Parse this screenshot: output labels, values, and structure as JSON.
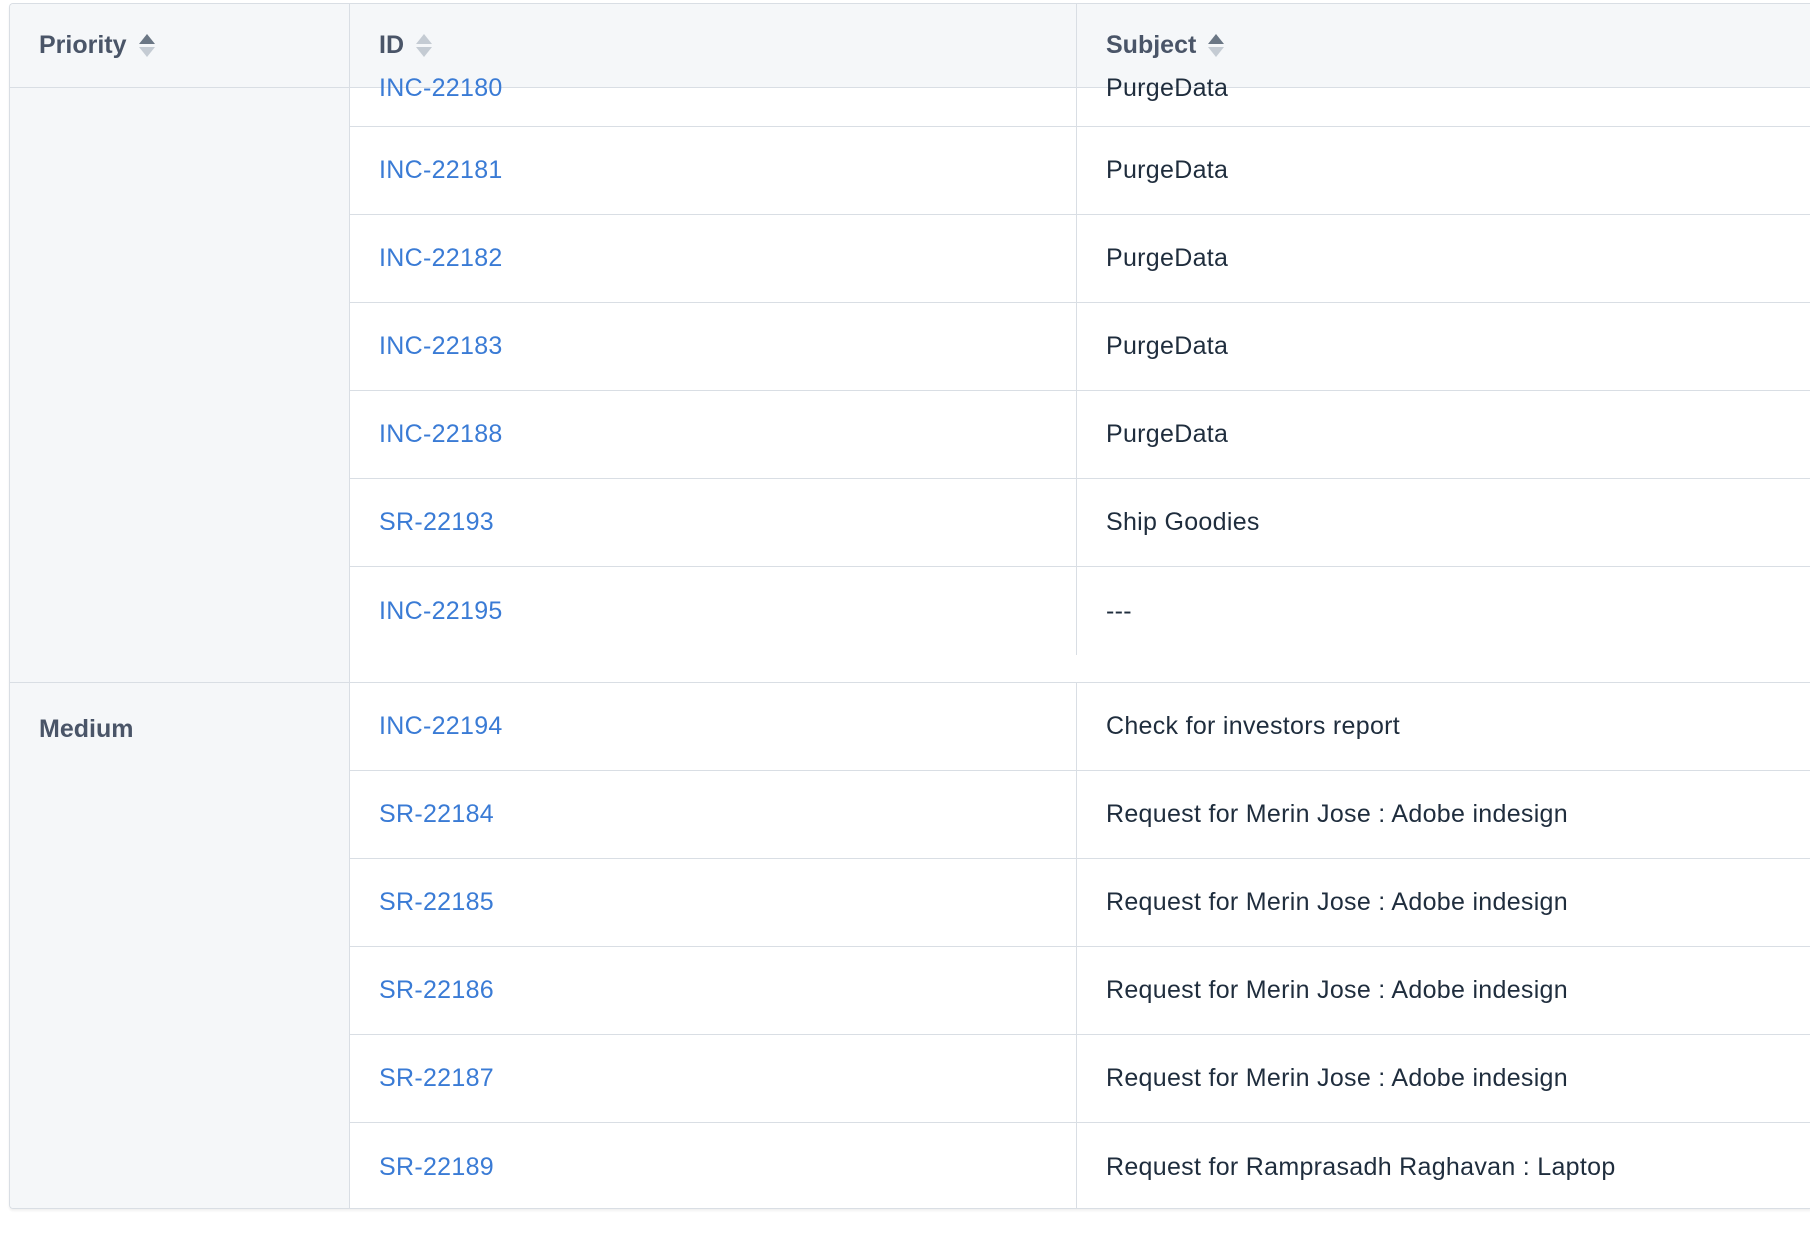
{
  "table": {
    "columns": [
      {
        "key": "priority",
        "label": "Priority",
        "sort": "asc"
      },
      {
        "key": "id",
        "label": "ID",
        "sort": "none"
      },
      {
        "key": "subject",
        "label": "Subject",
        "sort": "asc"
      }
    ],
    "groups": [
      {
        "priority": "",
        "rows": [
          {
            "id": "INC-22180",
            "subject": "PurgeData"
          },
          {
            "id": "INC-22181",
            "subject": "PurgeData"
          },
          {
            "id": "INC-22182",
            "subject": "PurgeData"
          },
          {
            "id": "INC-22183",
            "subject": "PurgeData"
          },
          {
            "id": "INC-22188",
            "subject": "PurgeData"
          },
          {
            "id": "SR-22193",
            "subject": "Ship Goodies"
          },
          {
            "id": "INC-22195",
            "subject": "---"
          }
        ]
      },
      {
        "priority": "Medium",
        "rows": [
          {
            "id": "INC-22194",
            "subject": "Check for investors report"
          },
          {
            "id": "SR-22184",
            "subject": "Request for Merin Jose : Adobe indesign"
          },
          {
            "id": "SR-22185",
            "subject": "Request for Merin Jose : Adobe indesign"
          },
          {
            "id": "SR-22186",
            "subject": "Request for Merin Jose : Adobe indesign"
          },
          {
            "id": "SR-22187",
            "subject": "Request for Merin Jose : Adobe indesign"
          },
          {
            "id": "SR-22189",
            "subject": "Request for Ramprasadh Raghavan : Laptop"
          }
        ]
      }
    ]
  },
  "colors": {
    "link": "#3a7bd5",
    "header_bg": "#f5f7f9",
    "border": "#d9dee4",
    "text": "#1f2d3d"
  }
}
